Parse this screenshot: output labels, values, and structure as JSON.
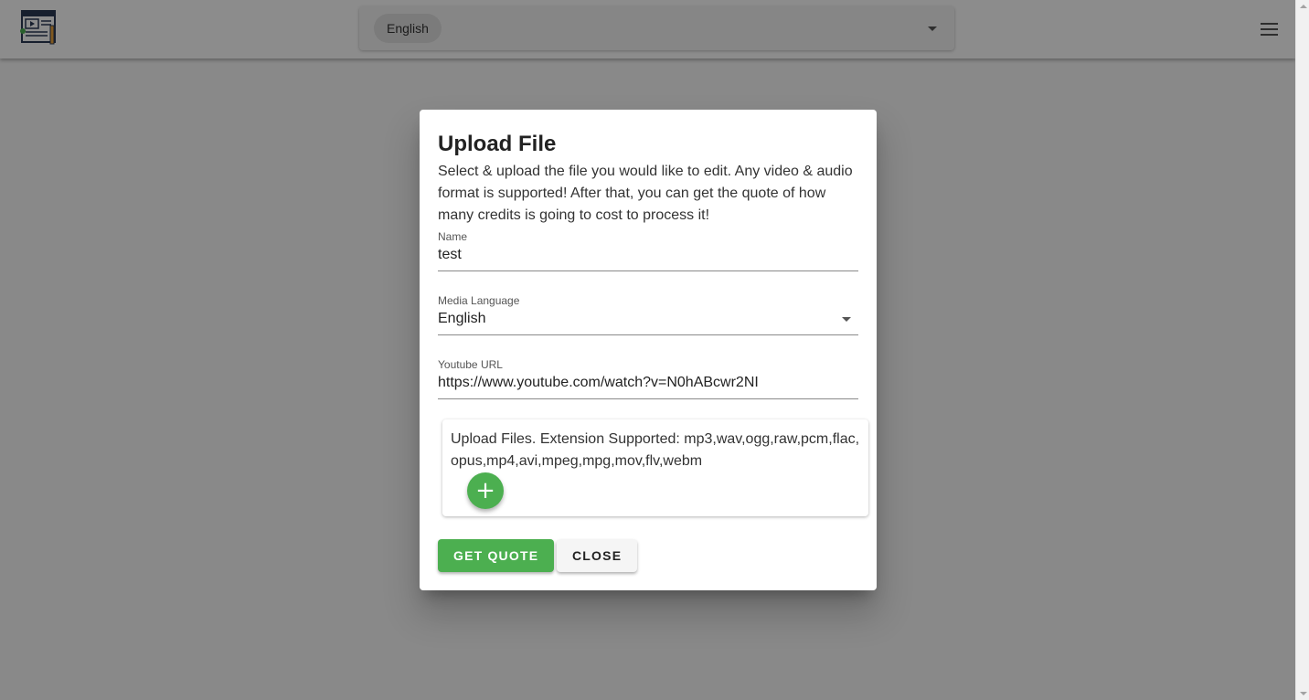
{
  "header": {
    "language_selected": "English",
    "logo_icon": "video-editor-logo-icon",
    "menu_icon": "hamburger-menu-icon"
  },
  "dialog": {
    "title": "Upload File",
    "description": "Select & upload the file you would like to edit. Any video & audio format is supported! After that, you can get the quote of how many credits is going to cost to process it!",
    "fields": {
      "name": {
        "label": "Name",
        "value": "test"
      },
      "media_language": {
        "label": "Media Language",
        "value": "English"
      },
      "youtube_url": {
        "label": "Youtube URL",
        "value": "https://www.youtube.com/watch?v=N0hABcwr2NI"
      }
    },
    "upload": {
      "text": "Upload Files. Extension Supported: mp3,wav,ogg,raw,pcm,flac,opus,mp4,avi,mpeg,mpg,mov,flv,webm",
      "add_symbol": "+"
    },
    "buttons": {
      "get_quote": "GET QUOTE",
      "close": "CLOSE"
    }
  },
  "colors": {
    "accent": "#4caf50",
    "overlay": "rgba(0,0,0,0.45)"
  }
}
